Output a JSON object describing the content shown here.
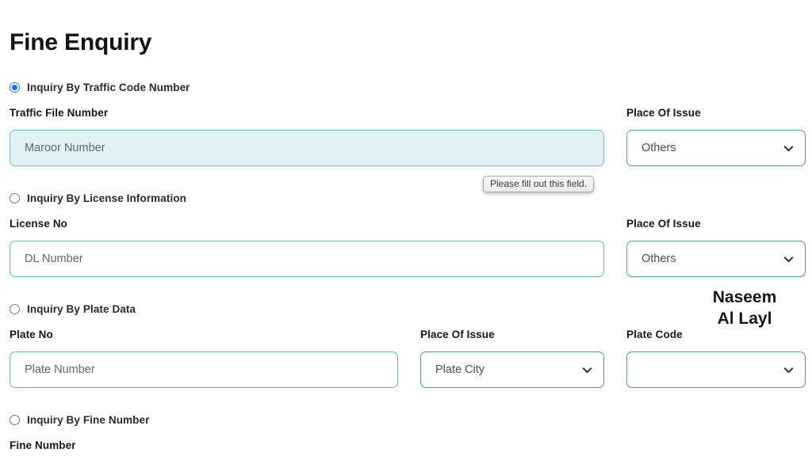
{
  "page": {
    "title": "Fine Enquiry"
  },
  "overlay": {
    "line1": "Naseem",
    "line2": "Al Layl"
  },
  "validation": {
    "message": "Please fill out this field."
  },
  "icons": {
    "chevron_down": "chevron-down-icon"
  },
  "sections": [
    {
      "radio": {
        "label": "Inquiry By Traffic Code Number",
        "checked": true
      },
      "fields": [
        {
          "label": "Traffic File Number",
          "type": "text",
          "value": "",
          "placeholder": "Maroor Number",
          "state": "invalid"
        },
        {
          "label": "Place Of Issue",
          "type": "select",
          "value": "Others"
        }
      ]
    },
    {
      "radio": {
        "label": "Inquiry By License Information",
        "checked": false
      },
      "fields": [
        {
          "label": "License No",
          "type": "text",
          "value": "",
          "placeholder": "DL Number",
          "state": "normal"
        },
        {
          "label": "Place Of Issue",
          "type": "select",
          "value": "Others"
        }
      ]
    },
    {
      "radio": {
        "label": "Inquiry By Plate Data",
        "checked": false
      },
      "fields": [
        {
          "label": "Plate No",
          "type": "text",
          "value": "",
          "placeholder": "Plate Number",
          "state": "normal"
        },
        {
          "label": "Place Of Issue",
          "type": "select",
          "value": "Plate City"
        },
        {
          "label": "Plate Code",
          "type": "select",
          "value": ""
        }
      ]
    },
    {
      "radio": {
        "label": "Inquiry By Fine Number",
        "checked": false
      },
      "fields": [
        {
          "label": "Fine Number",
          "type": "text",
          "value": "",
          "placeholder": "",
          "state": "normal"
        }
      ]
    }
  ]
}
